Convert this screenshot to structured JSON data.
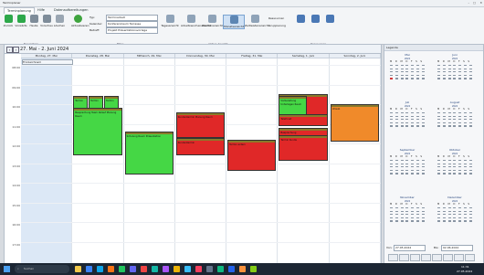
{
  "app": {
    "title": "Terminplaner"
  },
  "ribbon": {
    "tabs": [
      "Terminplanung",
      "Hilfe",
      "Datenaufbereitungen"
    ],
    "buttons": [
      {
        "label": "Zurück",
        "color": "#2da84a"
      },
      {
        "label": "Vorwärts",
        "color": "#2da84a"
      },
      {
        "label": "Heute",
        "color": "#6a7b8c"
      },
      {
        "label": "Vorschau",
        "color": "#6a7b8c"
      },
      {
        "label": "Löschen",
        "color": "#6a7b8c"
      },
      {
        "label": "Aktualisieren",
        "color": "#3ea43e"
      }
    ],
    "fields": {
      "typ_label": "Typ:",
      "typ_value": "Terminarbeit",
      "kalender_label": "Kalender:",
      "kalender_value": "Konferenzraum Terrasse",
      "betreff_label": "Betreff:",
      "betreff_value": "Projekt Präsentationsvorlage"
    },
    "view_buttons": [
      "Tagesansicht",
      "Arbeitswochenansicht",
      "Wochenansicht",
      "Monatsansicht",
      "Zeitleistenansicht"
    ],
    "option_buttons": [
      "Ressourcen",
      "Gruppierung"
    ],
    "group_labels": [
      "Navigation",
      "Filter",
      "Aktive Ansicht",
      "Ressourcen"
    ]
  },
  "calendar": {
    "range_title": "27. Mai - 2. Juni 2024",
    "days": [
      "Montag, 27. Mai",
      "Dienstag, 28. Mai",
      "Mittwoch, 29. Mai",
      "Donnerstag, 30. Mai",
      "Freitag, 31. Mai",
      "Samstag, 1. Juni",
      "Sonntag, 2. Juni"
    ],
    "allday_text": "Fronleichnam",
    "times": [
      "08:00",
      "09:00",
      "10:00",
      "11:00",
      "12:00",
      "13:00",
      "14:00",
      "15:00",
      "16:00",
      "17:00"
    ],
    "appointments": [
      {
        "day": 1,
        "start": 1.6,
        "end": 2.8,
        "color": "green",
        "text": "Termin"
      },
      {
        "day": 1,
        "start": 1.6,
        "end": 2.8,
        "color": "green",
        "text": "Termin",
        "offset": 0.3
      },
      {
        "day": 1,
        "start": 1.6,
        "end": 2.8,
        "color": "green",
        "text": "Termin",
        "offset": 0.6
      },
      {
        "day": 1,
        "start": 2.2,
        "end": 4.6,
        "color": "green",
        "text": "Besprechung Team Ablauf Planung Raum"
      },
      {
        "day": 3,
        "start": 2.4,
        "end": 3.7,
        "color": "red",
        "text": "Kundentermin Planung Raum"
      },
      {
        "day": 3,
        "start": 3.7,
        "end": 4.6,
        "color": "red",
        "text": "Kundentermin"
      },
      {
        "day": 2,
        "start": 3.4,
        "end": 5.6,
        "color": "green",
        "text": "Schulung Raum Präsentation"
      },
      {
        "day": 4,
        "start": 3.8,
        "end": 5.4,
        "color": "red",
        "text": "Termin extern"
      },
      {
        "day": 5,
        "start": 1.5,
        "end": 2.9,
        "color": "red",
        "text": "Projektbesprechung"
      },
      {
        "day": 5,
        "start": 1.6,
        "end": 2.7,
        "color": "green",
        "text": "Vorbereitung Unterlagen Raum"
      },
      {
        "day": 5,
        "start": 2.5,
        "end": 3.1,
        "color": "red",
        "text": "Telefonat"
      },
      {
        "day": 5,
        "start": 3.2,
        "end": 4.6,
        "color": "red",
        "text": "Besprechung"
      },
      {
        "day": 5,
        "start": 3.6,
        "end": 4.9,
        "color": "red",
        "text": "Termin Kunde"
      },
      {
        "day": 6,
        "start": 2.0,
        "end": 3.9,
        "color": "orange",
        "text": "Urlaub"
      }
    ]
  },
  "sidepanel": {
    "title": "Legende",
    "months": [
      "Mai",
      "Juni",
      "Juli",
      "August",
      "September",
      "Oktober",
      "November",
      "Dezember"
    ],
    "year": "2024",
    "weekday_header": "M D M D F S S",
    "from_label": "Von:",
    "from_value": "27.05.2024",
    "to_label": "Bis:",
    "to_value": "02.06.2024"
  },
  "taskbar": {
    "search_placeholder": "Suchen",
    "time": "11:31",
    "date": "27.05.2024"
  }
}
